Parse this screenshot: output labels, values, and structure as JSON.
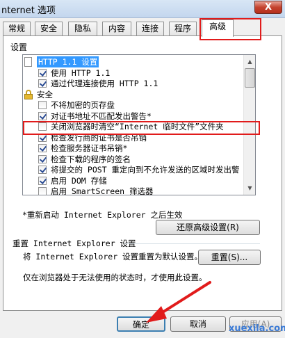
{
  "window": {
    "title": "nternet 选项",
    "close_label": "X"
  },
  "tabs": [
    "常规",
    "安全",
    "隐私",
    "内容",
    "连接",
    "程序",
    "高级"
  ],
  "settings_label": "设置",
  "tree": [
    {
      "type": "doc",
      "text": "HTTP 1.1 设置",
      "selected": true
    },
    {
      "type": "checkbox",
      "checked": true,
      "text": "使用 HTTP 1.1"
    },
    {
      "type": "checkbox",
      "checked": true,
      "text": "通过代理连接使用 HTTP 1.1"
    },
    {
      "type": "lock",
      "text": "安全"
    },
    {
      "type": "checkbox",
      "checked": false,
      "text": "不将加密的页存盘"
    },
    {
      "type": "checkbox",
      "checked": true,
      "text": "对证书地址不匹配发出警告*"
    },
    {
      "type": "checkbox",
      "checked": false,
      "text": "关闭浏览器时清空“Internet 临时文件”文件夹"
    },
    {
      "type": "checkbox",
      "checked": true,
      "text": "检查发行商的证书是否吊销"
    },
    {
      "type": "checkbox",
      "checked": true,
      "text": "检查服务器证书吊销*"
    },
    {
      "type": "checkbox",
      "checked": true,
      "text": "检查下载的程序的签名"
    },
    {
      "type": "checkbox",
      "checked": true,
      "text": "将提交的 POST 重定向到不允许发送的区域时发出警"
    },
    {
      "type": "checkbox",
      "checked": true,
      "text": "启用 DOM 存储"
    },
    {
      "type": "checkbox",
      "checked": false,
      "text": "启用 SmartScreen 筛选器"
    }
  ],
  "restart_note": "*重新启动 Internet Explorer 之后生效",
  "restore_button": "还原高级设置(R)",
  "reset_group_title": "重置 Internet Explorer 设置",
  "reset_desc": "将 Internet Explorer 设置重置为默认设置。",
  "reset_button": "重置(S)...",
  "unusable_note": "仅在浏览器处于无法使用的状态时，才使用此设置。",
  "footer": {
    "ok": "确定",
    "cancel": "取消",
    "apply": "应用(A)"
  },
  "watermark": "xuexila.com",
  "colors": {
    "annotation": "#e11b1b",
    "selection": "#3399ff"
  }
}
